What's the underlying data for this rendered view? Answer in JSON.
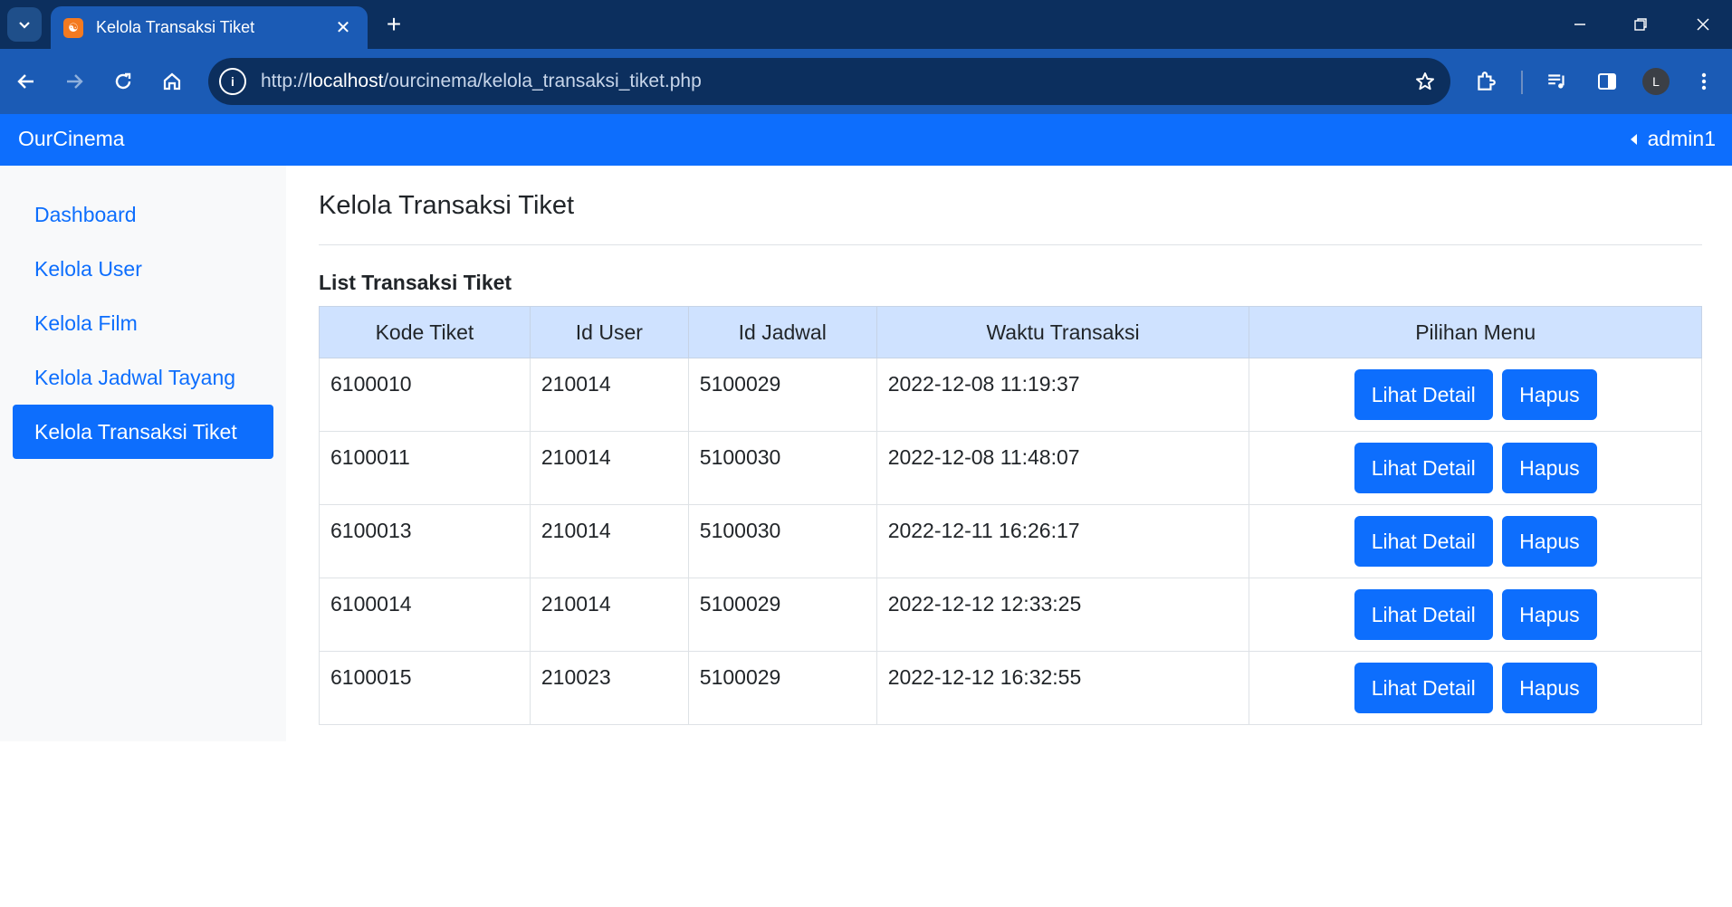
{
  "browser": {
    "tab_title": "Kelola Transaksi Tiket",
    "tab_favicon": "xampp-icon",
    "url_prefix": "http://",
    "url_host": "localhost",
    "url_path": "/ourcinema/kelola_transaksi_tiket.php",
    "avatar_letter": "L"
  },
  "navbar": {
    "brand": "OurCinema",
    "user": "admin1"
  },
  "sidebar": {
    "items": [
      {
        "label": "Dashboard",
        "active": false
      },
      {
        "label": "Kelola User",
        "active": false
      },
      {
        "label": "Kelola Film",
        "active": false
      },
      {
        "label": "Kelola Jadwal Tayang",
        "active": false
      },
      {
        "label": "Kelola Transaksi Tiket",
        "active": true
      }
    ]
  },
  "main": {
    "title": "Kelola Transaksi Tiket",
    "section_title": "List Transaksi Tiket",
    "table": {
      "headers": [
        "Kode Tiket",
        "Id User",
        "Id Jadwal",
        "Waktu Transaksi",
        "Pilihan Menu"
      ],
      "rows": [
        {
          "kode": "6100010",
          "user": "210014",
          "jadwal": "5100029",
          "waktu": "2022-12-08 11:19:37"
        },
        {
          "kode": "6100011",
          "user": "210014",
          "jadwal": "5100030",
          "waktu": "2022-12-08 11:48:07"
        },
        {
          "kode": "6100013",
          "user": "210014",
          "jadwal": "5100030",
          "waktu": "2022-12-11 16:26:17"
        },
        {
          "kode": "6100014",
          "user": "210014",
          "jadwal": "5100029",
          "waktu": "2022-12-12 12:33:25"
        },
        {
          "kode": "6100015",
          "user": "210023",
          "jadwal": "5100029",
          "waktu": "2022-12-12 16:32:55"
        }
      ],
      "detail_label": "Lihat Detail",
      "delete_label": "Hapus"
    }
  },
  "colors": {
    "primary": "#0d6efd",
    "chrome_dark": "#0c2f5e",
    "chrome_toolbar": "#1b5bb5",
    "table_header": "#cfe2ff",
    "sidebar_bg": "#f8f9fa"
  }
}
